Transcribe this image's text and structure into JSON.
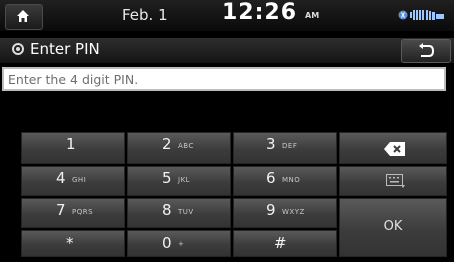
{
  "status": {
    "date": "Feb. 1",
    "time": "12:26",
    "ampm": "AM"
  },
  "header": {
    "title": "Enter PIN"
  },
  "pin_input": {
    "placeholder": "Enter the 4 digit PIN.",
    "value": ""
  },
  "keypad": {
    "keys": [
      {
        "digit": "1",
        "letters": ""
      },
      {
        "digit": "2",
        "letters": "ABC"
      },
      {
        "digit": "3",
        "letters": "DEF"
      },
      {
        "digit": "4",
        "letters": "GHI"
      },
      {
        "digit": "5",
        "letters": "JKL"
      },
      {
        "digit": "6",
        "letters": "MNO"
      },
      {
        "digit": "7",
        "letters": "PQRS"
      },
      {
        "digit": "8",
        "letters": "TUV"
      },
      {
        "digit": "9",
        "letters": "WXYZ"
      },
      {
        "digit": "*",
        "letters": ""
      },
      {
        "digit": "0",
        "letters": "+"
      },
      {
        "digit": "#",
        "letters": ""
      }
    ],
    "ok_label": "OK"
  },
  "icons": {
    "home": "home-icon",
    "back": "back-arrow-icon",
    "backspace": "backspace-icon",
    "keyboard": "keyboard-icon",
    "status": "bluetooth-signal-battery-icons"
  }
}
